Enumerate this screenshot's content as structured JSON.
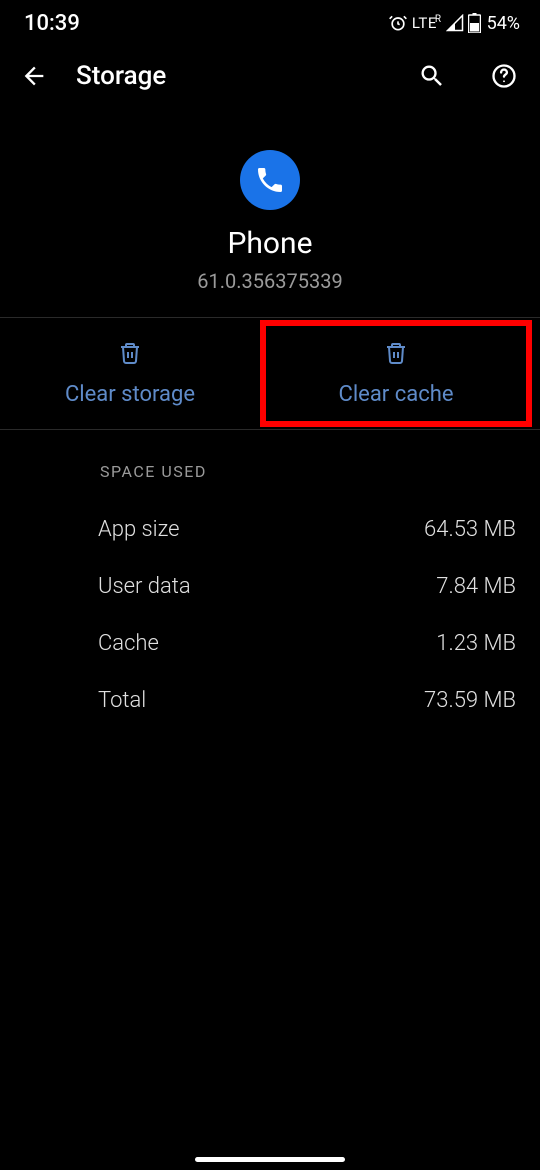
{
  "status": {
    "time": "10:39",
    "lte": "LTE",
    "lte_suffix": "R",
    "battery": "54%"
  },
  "header": {
    "title": "Storage"
  },
  "app": {
    "name": "Phone",
    "version": "61.0.356375339"
  },
  "actions": {
    "clear_storage": "Clear storage",
    "clear_cache": "Clear cache"
  },
  "section": {
    "title": "SPACE USED",
    "rows": [
      {
        "label": "App size",
        "value": "64.53 MB"
      },
      {
        "label": "User data",
        "value": "7.84 MB"
      },
      {
        "label": "Cache",
        "value": "1.23 MB"
      },
      {
        "label": "Total",
        "value": "73.59 MB"
      }
    ]
  }
}
